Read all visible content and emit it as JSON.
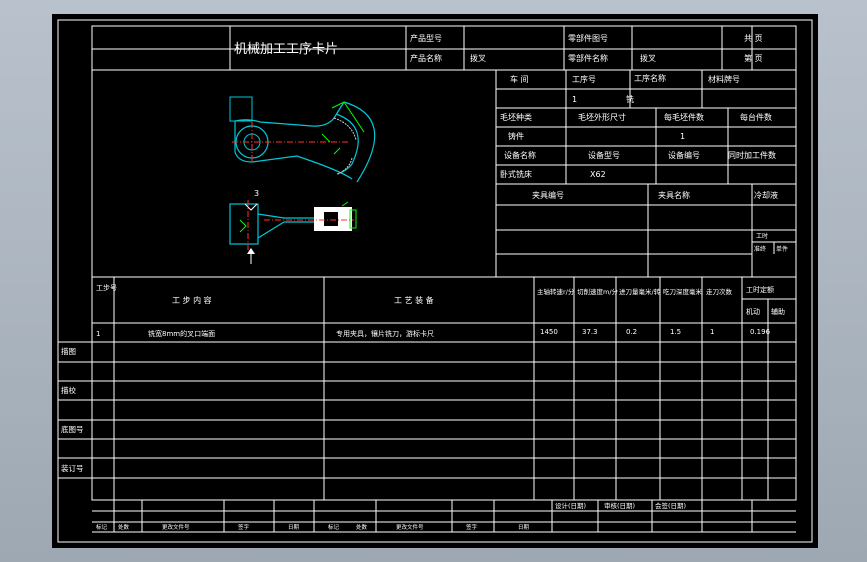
{
  "header": {
    "card_title": "机械加工工序卡片",
    "product_model_label": "产品型号",
    "part_drawing_no_label": "零部件图号",
    "product_name_label": "产品名称",
    "product_name_value": "拨叉",
    "part_name_label": "零部件名称",
    "part_name_value": "拨叉",
    "total_pages_label": "共 页",
    "page_no_label": "第 页"
  },
  "info": {
    "workshop_label": "车 间",
    "process_no_label": "工序号",
    "process_name_label": "工序名称",
    "material_label": "材料牌号",
    "process_no_value": "1",
    "process_name_value": "铣",
    "blank_type_label": "毛坯种类",
    "blank_size_label": "毛坯外形尺寸",
    "blanks_per_label": "每毛坯件数",
    "pieces_per_label": "每台件数",
    "blank_type_value": "铸件",
    "blanks_per_value": "1",
    "equip_name_label": "设备名称",
    "equip_model_label": "设备型号",
    "equip_no_label": "设备编号",
    "simultaneous_label": "同时加工件数",
    "equip_name_value": "卧式铣床",
    "equip_model_value": "X62",
    "fixture_no_label": "夹具编号",
    "fixture_name_label": "夹具名称",
    "coolant_label": "冷却液",
    "hours_label": "工时",
    "hours_sub1": "准终",
    "hours_sub2": "单件"
  },
  "drawing": {
    "dimension_label": "3"
  },
  "table": {
    "headers": {
      "step_no": "工步号",
      "step_content": "工 步 内 容",
      "equipment": "工 艺 装 备",
      "spindle_speed": "主轴转速r/分",
      "cutting_speed": "切削速度m/分",
      "feed": "进刀量毫米/转",
      "depth": "吃刀深度毫米",
      "passes": "走刀次数",
      "quota": "工时定额",
      "quota_machine": "机动",
      "quota_aux": "辅助"
    },
    "rows": [
      {
        "step_no": "1",
        "step_content": "铣宽8mm的叉口端面",
        "equipment": "专用夹具，镶片铣刀，游标卡尺",
        "spindle_speed": "1450",
        "cutting_speed": "37.3",
        "feed": "0.2",
        "depth": "1.5",
        "passes": "1",
        "quota_machine": "0.196"
      }
    ]
  },
  "side_labels": {
    "trace": "描图",
    "check": "描校",
    "base_no": "底图号",
    "binding_no": "装订号"
  },
  "footer": {
    "design_date": "设计(日期)",
    "review_date": "审核(日期)",
    "standard_date": "会签(日期)",
    "mark_labels": [
      "标记",
      "处数",
      "更改文件号",
      "签字",
      "日期",
      "标记",
      "处数",
      "更改文件号",
      "签字",
      "日期"
    ]
  },
  "colors": {
    "background": "#000000",
    "line": "#ffffff",
    "part_outline": "#00c8d8",
    "centerline": "#ff3030",
    "dimension": "#00ff00",
    "hatch": "#d0d0d0",
    "frame_bg": "#a8b2bd"
  }
}
